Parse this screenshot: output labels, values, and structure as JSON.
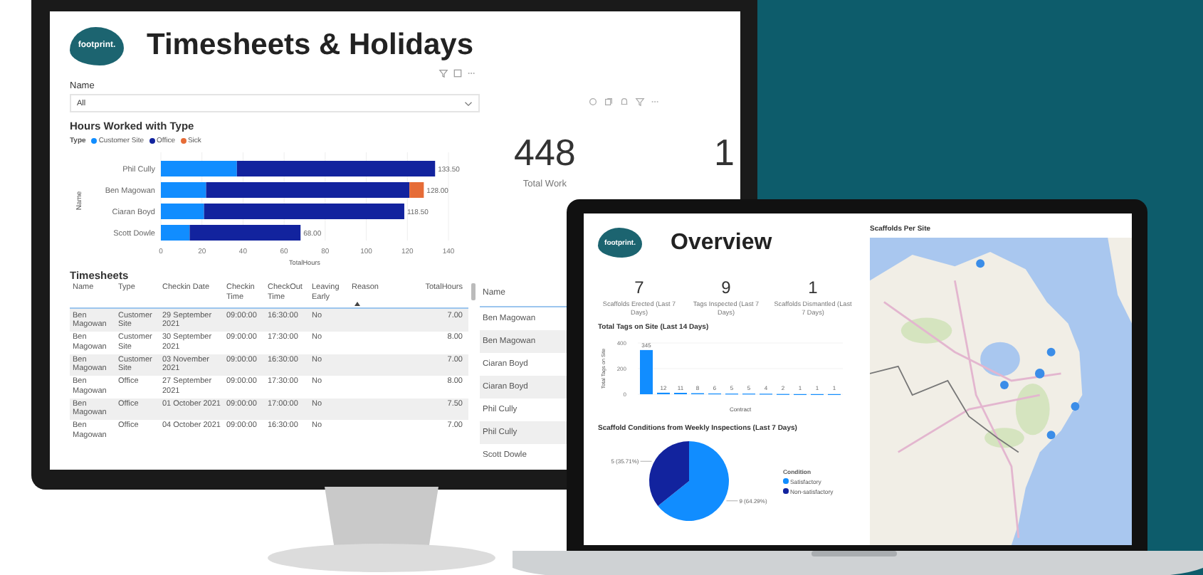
{
  "monitor": {
    "logo": "footprint.",
    "title": "Timesheets & Holidays",
    "slicer": {
      "label": "Name",
      "value": "All"
    },
    "hours_chart": {
      "title": "Hours Worked with Type",
      "legend_title": "Type",
      "chart_data": {
        "type": "bar",
        "orientation": "horizontal",
        "stacked": true,
        "xlabel": "TotalHours",
        "ylabel": "Name",
        "categories": [
          "Phil Cully",
          "Ben Magowan",
          "Ciaran Boyd",
          "Scott Dowle"
        ],
        "series": [
          {
            "name": "Customer Site",
            "color": "#118dff",
            "values": [
              37,
              22,
              21,
              14
            ]
          },
          {
            "name": "Office",
            "color": "#12239e",
            "values": [
              96.5,
              99,
              97.5,
              54
            ]
          },
          {
            "name": "Sick",
            "color": "#e66c37",
            "values": [
              null,
              7,
              null,
              null
            ]
          }
        ],
        "xlim": [
          0,
          140
        ],
        "xticks": [
          0,
          20,
          40,
          60,
          80,
          100,
          120,
          140
        ],
        "grid": true,
        "value_labels": [
          "133.50",
          "128.00",
          "118.50",
          "68.00"
        ]
      }
    },
    "kpis": [
      {
        "value": "448",
        "label": "Total Work"
      },
      {
        "value": "1"
      }
    ],
    "timesheets": {
      "title": "Timesheets",
      "columns": [
        "Name",
        "Type",
        "Checkin Date",
        "Checkin Time",
        "CheckOut Time",
        "Leaving Early",
        "Reason",
        "TotalHours"
      ],
      "rows": [
        [
          "Ben Magowan",
          "Customer Site",
          "29 September 2021",
          "09:00:00",
          "16:30:00",
          "No",
          "",
          "7.00"
        ],
        [
          "Ben Magowan",
          "Customer Site",
          "30 September 2021",
          "09:00:00",
          "17:30:00",
          "No",
          "",
          "8.00"
        ],
        [
          "Ben Magowan",
          "Customer Site",
          "03 November 2021",
          "09:00:00",
          "16:30:00",
          "No",
          "",
          "7.00"
        ],
        [
          "Ben Magowan",
          "Office",
          "27 September 2021",
          "09:00:00",
          "17:30:00",
          "No",
          "",
          "8.00"
        ],
        [
          "Ben Magowan",
          "Office",
          "01 October 2021",
          "09:00:00",
          "17:00:00",
          "No",
          "",
          "7.50"
        ],
        [
          "Ben Magowan",
          "Office",
          "04 October 2021",
          "09:00:00",
          "16:30:00",
          "No",
          "",
          "7.00"
        ]
      ]
    },
    "name_table": {
      "column": "Name",
      "rows": [
        "Ben Magowan",
        "Ben Magowan",
        "Ciaran Boyd",
        "Ciaran Boyd",
        "Phil Cully",
        "Phil Cully",
        "Scott Dowle"
      ]
    }
  },
  "laptop": {
    "logo": "footprint.",
    "title": "Overview",
    "kpis": [
      {
        "value": "7",
        "label": "Scaffolds Erected (Last 7 Days)"
      },
      {
        "value": "9",
        "label": "Tags Inspected (Last 7 Days)"
      },
      {
        "value": "1",
        "label": "Scaffolds Dismantled (Last 7 Days)"
      }
    ],
    "tags_chart": {
      "title": "Total Tags on Site (Last 14 Days)",
      "chart_data": {
        "type": "bar",
        "ylabel": "Total Tags on Site",
        "xlabel": "Contract",
        "series": [
          {
            "color": "#118dff",
            "values": [
              345,
              12,
              11,
              8,
              6,
              5,
              5,
              4,
              2,
              1,
              1,
              1
            ]
          }
        ],
        "ylim": [
          0,
          400
        ],
        "yticks": [
          0,
          200,
          400
        ],
        "grid": true,
        "data_labels": true
      }
    },
    "conditions_chart": {
      "title": "Scaffold Conditions from Weekly Inspections (Last 7 Days)",
      "legend_title": "Condition",
      "chart_data": {
        "type": "pie",
        "categories": [
          "Satisfactory",
          "Non-satisfactory"
        ],
        "values": [
          9,
          5
        ],
        "value_labels": [
          "9 (64.29%)",
          "5 (35.71%)"
        ]
      },
      "legend": [
        {
          "color": "#118dff"
        },
        {
          "color": "#12239e"
        }
      ]
    },
    "map": {
      "title": "Scaffolds Per Site",
      "kind": "picture"
    }
  }
}
